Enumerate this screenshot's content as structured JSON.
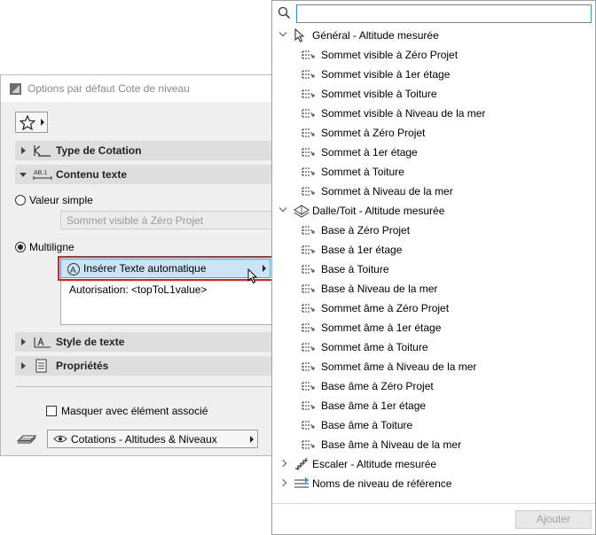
{
  "dialog": {
    "title": "Options par défaut Cote de niveau",
    "sections": {
      "type_cotation": "Type de Cotation",
      "contenu_texte": "Contenu texte",
      "style_texte": "Style de texte",
      "proprietes": "Propriétés"
    },
    "radio_simple": "Valeur simple",
    "simple_value": "Sommet visible à Zéro Projet",
    "radio_multi": "Multiligne",
    "insert_button": "Insérer Texte automatique",
    "textarea_text": "Autorisation: <topToL1value>",
    "checkbox_label": "Masquer avec élément associé",
    "layer_label": "Cotations - Altitudes & Niveaux"
  },
  "popup": {
    "search_placeholder": "",
    "categories": [
      {
        "label": "Général - Altitude mesurée",
        "expanded": true,
        "items": [
          "Sommet visible à Zéro Projet",
          "Sommet visible à 1er étage",
          "Sommet visible à Toiture",
          "Sommet visible à Niveau de la mer",
          "Sommet à Zéro Projet",
          "Sommet à 1er étage",
          "Sommet à Toiture",
          "Sommet à Niveau de la mer"
        ]
      },
      {
        "label": "Dalle/Toit - Altitude mesurée",
        "expanded": true,
        "items": [
          "Base à Zéro Projet",
          "Base à 1er étage",
          "Base à Toiture",
          "Base à Niveau de la mer",
          "Sommet âme à Zéro Projet",
          "Sommet âme à 1er étage",
          "Sommet âme à Toiture",
          "Sommet âme à Niveau de la mer",
          "Base âme à Zéro Projet",
          "Base âme à 1er étage",
          "Base âme à Toiture",
          "Base âme à Niveau de la mer"
        ]
      },
      {
        "label": "Escaler - Altitude mesurée",
        "expanded": false,
        "items": []
      },
      {
        "label": "Noms de niveau de référence",
        "expanded": false,
        "items": []
      }
    ],
    "add_button": "Ajouter"
  },
  "colors": {
    "highlight_border": "#e0201b",
    "selected_bg": "#cce4f7",
    "accent": "#3c8fd8"
  }
}
